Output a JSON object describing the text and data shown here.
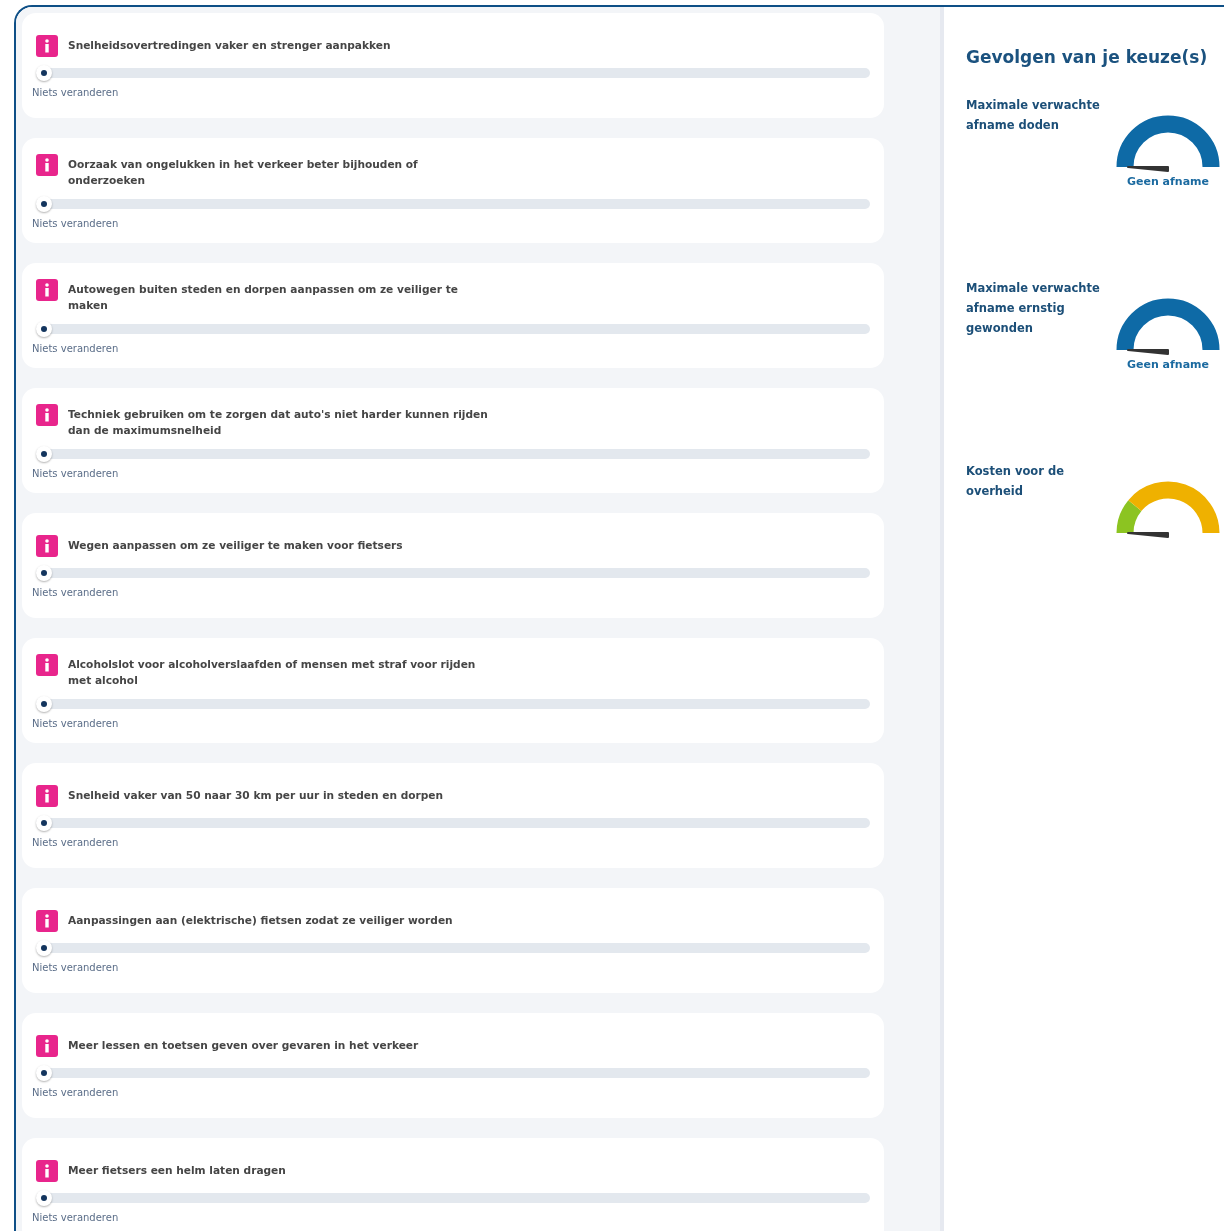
{
  "measures": [
    {
      "title": "Snelheidsovertredingen vaker en strenger aanpakken",
      "level": 0,
      "value_label": "Niets veranderen"
    },
    {
      "title": "Oorzaak van ongelukken in het verkeer beter bijhouden of onderzoeken",
      "level": 0,
      "value_label": "Niets veranderen"
    },
    {
      "title": "Autowegen buiten steden en dorpen aanpassen om ze veiliger te maken",
      "level": 0,
      "value_label": "Niets veranderen"
    },
    {
      "title": "Techniek gebruiken om te zorgen dat auto's niet harder kunnen rijden dan de maximumsnelheid",
      "level": 0,
      "value_label": "Niets veranderen"
    },
    {
      "title": "Wegen aanpassen om ze veiliger te maken voor fietsers",
      "level": 0,
      "value_label": "Niets veranderen"
    },
    {
      "title": "Alcoholslot voor alcoholverslaafden of mensen met straf voor rijden met alcohol",
      "level": 0,
      "value_label": "Niets veranderen"
    },
    {
      "title": "Snelheid vaker van 50 naar 30 km per uur in steden en dorpen",
      "level": 0,
      "value_label": "Niets veranderen"
    },
    {
      "title": "Aanpassingen aan (elektrische) fietsen zodat ze veiliger worden",
      "level": 0,
      "value_label": "Niets veranderen"
    },
    {
      "title": "Meer lessen en toetsen geven over gevaren in het verkeer",
      "level": 0,
      "value_label": "Niets veranderen"
    },
    {
      "title": "Meer fietsers een helm laten dragen",
      "level": 0,
      "value_label": "Niets veranderen"
    }
  ],
  "results": {
    "title": "Gevolgen van je keuze(s)",
    "metrics": [
      {
        "label": "Maximale verwachte afname doden",
        "reading": "Geen afname",
        "segments": [
          {
            "color": "#0e6aa6"
          }
        ]
      },
      {
        "label": "Maximale verwachte afname ernstig gewonden",
        "reading": "Geen afname",
        "segments": [
          {
            "color": "#0e6aa6"
          }
        ]
      },
      {
        "label": "Kosten voor de overheid",
        "segments": [
          {
            "color": "#8cc421"
          },
          {
            "color": "#efb100"
          }
        ]
      }
    ]
  }
}
